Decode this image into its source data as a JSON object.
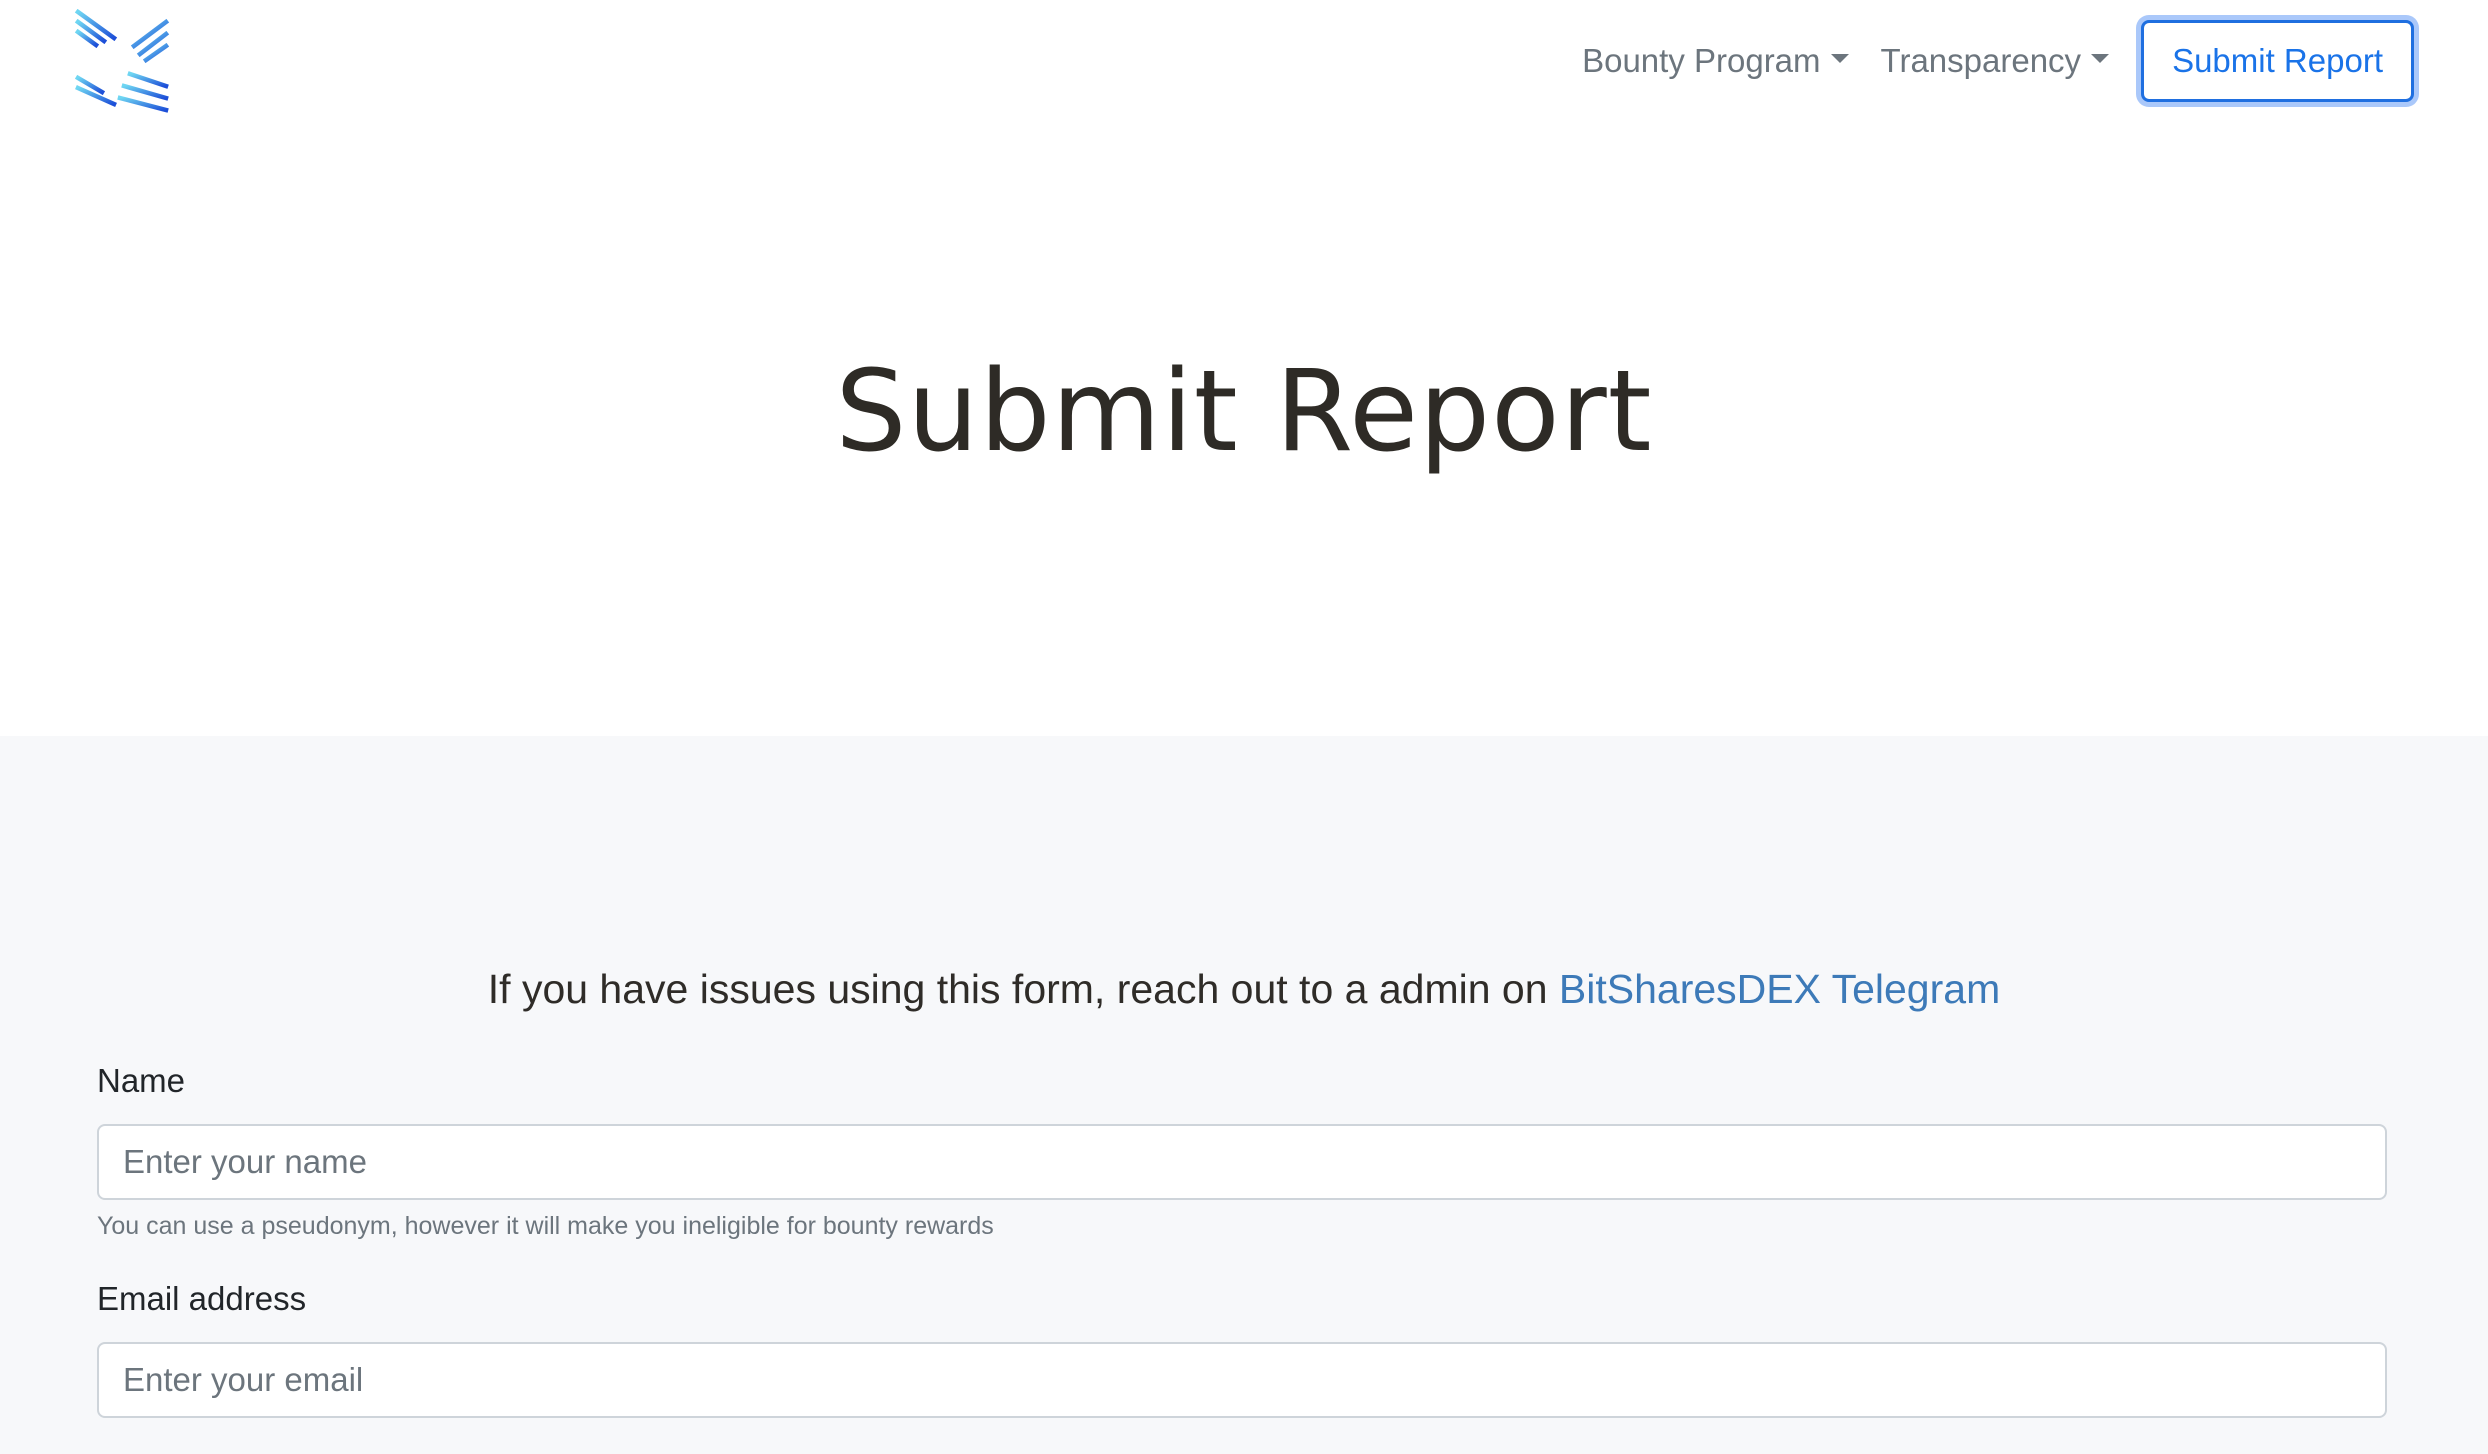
{
  "navbar": {
    "logo_alt": "logo",
    "items": [
      {
        "label": "Bounty Program",
        "dropdown": true
      },
      {
        "label": "Transparency",
        "dropdown": true
      }
    ],
    "submit_button": "Submit Report"
  },
  "hero": {
    "title": "Submit Report"
  },
  "form": {
    "notice_text": "If you have issues using this form, reach out to a admin on ",
    "notice_link": "BitSharesDEX Telegram",
    "name": {
      "label": "Name",
      "placeholder": "Enter your name",
      "value": "",
      "help": "You can use a pseudonym, however it will make you ineligible for bounty rewards"
    },
    "email": {
      "label": "Email address",
      "placeholder": "Enter your email",
      "value": ""
    }
  },
  "colors": {
    "accent": "#1a73e8",
    "link": "#3d7ab8",
    "section_bg": "#f7f8fa",
    "logo_light": "#5ec7ee",
    "logo_dark": "#1d4fd8"
  },
  "icons": [
    "brand-logo-icon",
    "caret-down-icon"
  ]
}
